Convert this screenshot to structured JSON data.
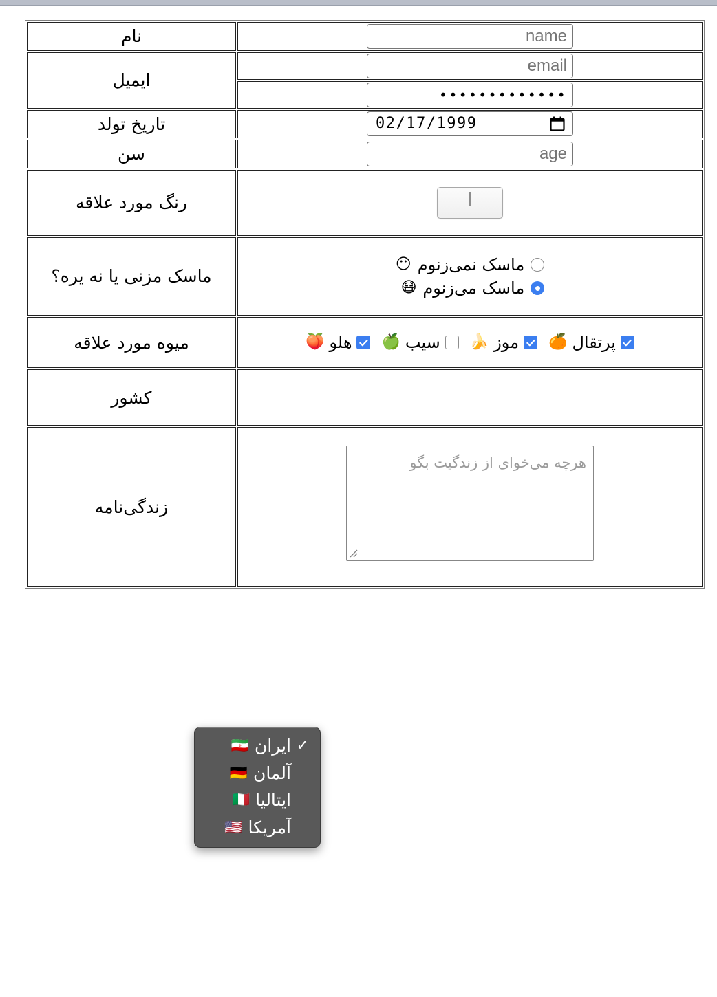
{
  "rows": [
    {
      "label": "نام",
      "field": "name-input"
    },
    {
      "label": "ایمیل",
      "field": "email-input"
    },
    {
      "label": "تاریخ تولد",
      "field": "date-input"
    },
    {
      "label": "سن",
      "field": "age-input"
    },
    {
      "label": "رنگ مورد علاقه",
      "field": "color-input"
    },
    {
      "label": "ماسک مزنی یا نه یره؟",
      "field": "mask-radios"
    },
    {
      "label": "میوه مورد علاقه",
      "field": "fruit-checkboxes"
    },
    {
      "label": "کشور",
      "field": "country-select"
    },
    {
      "label": "زندگی‌نامه",
      "field": "bio-textarea"
    }
  ],
  "fields": {
    "name": {
      "placeholder": "name",
      "value": ""
    },
    "email": {
      "placeholder": "email",
      "value": ""
    },
    "password": {
      "value": "•••••••••••••"
    },
    "birthdate": {
      "value": "02/17/1999"
    },
    "age": {
      "placeholder": "age",
      "value": ""
    },
    "color": {
      "value": "#419a3b"
    },
    "bio": {
      "placeholder": "هرچه می‌خوای از زندگیت بگو"
    }
  },
  "mask_options": [
    {
      "label": "ماسک نمی‌زنوم",
      "emoji": "😶",
      "checked": false
    },
    {
      "label": "ماسک می‌زنوم",
      "emoji": "😷",
      "checked": true
    }
  ],
  "fruit_options": [
    {
      "label": "پرتقال",
      "emoji": "🍊",
      "checked": true
    },
    {
      "label": "موز",
      "emoji": "🍌",
      "checked": true
    },
    {
      "label": "سیب",
      "emoji": "🍏",
      "checked": false
    },
    {
      "label": "هلو",
      "emoji": "🍑",
      "checked": true
    }
  ],
  "country_options": [
    {
      "label": "ایران",
      "flag": "🇮🇷",
      "selected": true
    },
    {
      "label": "آلمان",
      "flag": "🇩🇪",
      "selected": false
    },
    {
      "label": "ایتالیا",
      "flag": "🇮🇹",
      "selected": false
    },
    {
      "label": "آمریکا",
      "flag": "🇺🇸",
      "selected": false
    }
  ],
  "colors": {
    "accent_blue": "#3b7ef0",
    "swatch_green": "#419a3b",
    "popup_bg": "#595959",
    "table_border": "#808080",
    "cell_border": "#222222"
  },
  "glyphs": {
    "check_mark": "✓"
  }
}
